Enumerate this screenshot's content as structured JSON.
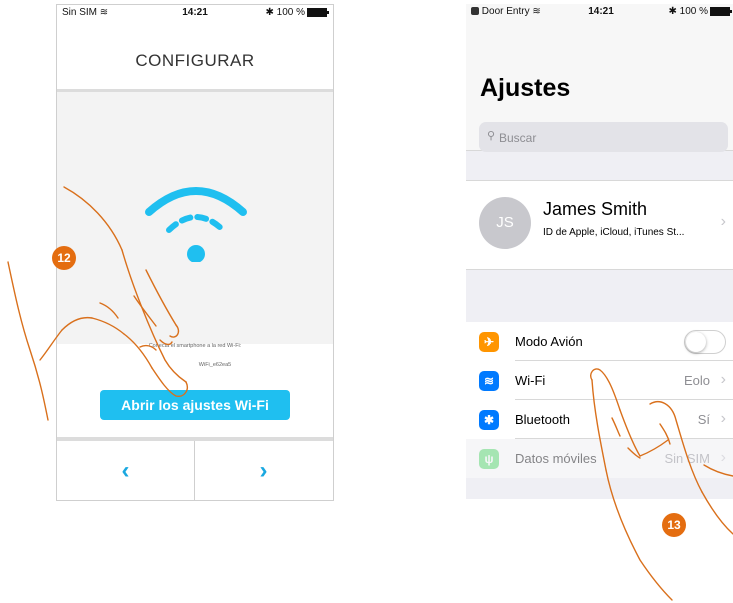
{
  "left_phone": {
    "status_bar": {
      "carrier": "Sin SIM",
      "time": "14:21",
      "battery": "100 %"
    },
    "title": "CONFIGURAR",
    "instruction_line1": "Conecta el smartphone a la red Wi-Fi:",
    "instruction_line2": "WiFi_e62ea5",
    "open_wifi_button": "Abrir los ajustes Wi-Fi",
    "nav_prev": "‹",
    "nav_next": "›"
  },
  "right_phone": {
    "status_bar": {
      "back_app": "Door Entry",
      "time": "14:21",
      "battery": "100 %"
    },
    "title": "Ajustes",
    "search_placeholder": "Buscar",
    "profile": {
      "initials": "JS",
      "name": "James Smith",
      "subtitle": "ID de Apple, iCloud, iTunes St..."
    },
    "rows": [
      {
        "label": "Modo Avión",
        "value": "",
        "color": "#ff9500"
      },
      {
        "label": "Wi-Fi",
        "value": "Eolo",
        "color": "#007aff"
      },
      {
        "label": "Bluetooth",
        "value": "Sí",
        "color": "#007aff"
      },
      {
        "label": "Datos móviles",
        "value": "Sin SIM",
        "color": "#4cd964"
      }
    ]
  },
  "badges": {
    "step_a": "12",
    "step_b": "13"
  },
  "colors": {
    "accent": "#1fbff0",
    "badge": "#e46d10",
    "hand_stroke": "#d9701c"
  }
}
